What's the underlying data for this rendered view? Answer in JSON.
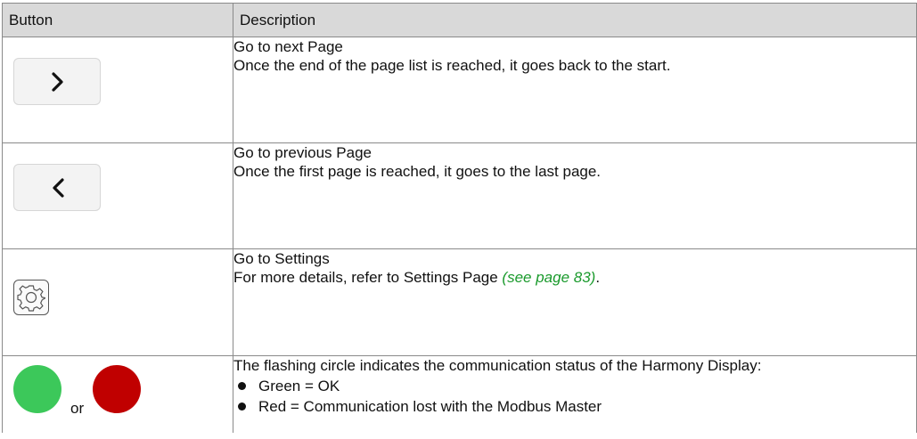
{
  "table": {
    "headers": {
      "button": "Button",
      "description": "Description"
    },
    "rows": [
      {
        "icon": "chevron-right-icon",
        "title": "Go to next Page",
        "detail": "Once the end of the page list is reached, it goes back to the start."
      },
      {
        "icon": "chevron-left-icon",
        "title": "Go to previous Page",
        "detail": "Once the first page is reached, it goes to the last page."
      },
      {
        "icon": "gear-icon",
        "title": "Go to Settings",
        "detail_prefix": "For more details, refer to Settings Page ",
        "detail_link": "(see page 83)",
        "detail_suffix": "."
      },
      {
        "icons": [
          "green-status-dot",
          "red-status-dot"
        ],
        "connector": "or",
        "title": "The flashing circle indicates the communication status of the Harmony Display:",
        "bullets": [
          "Green = OK",
          "Red = Communication lost with the Modbus Master"
        ]
      }
    ]
  },
  "colors": {
    "header_bg": "#d9d9d9",
    "link": "#1a9a2c",
    "status_ok": "#3cc85a",
    "status_lost": "#c00000"
  }
}
